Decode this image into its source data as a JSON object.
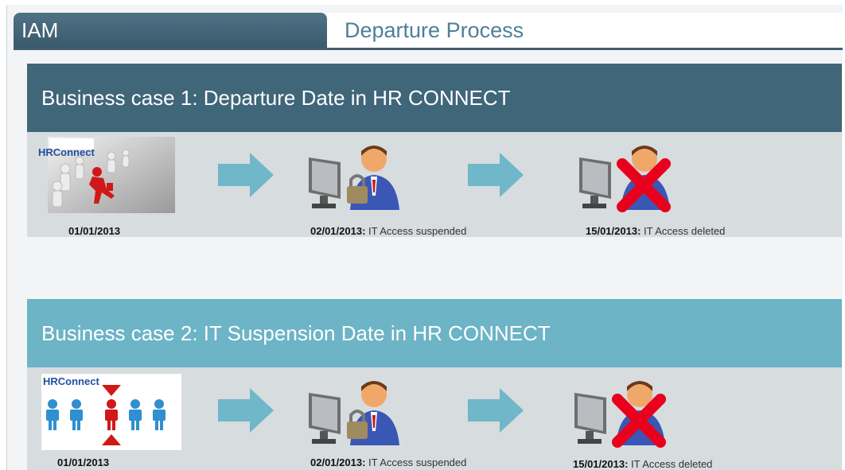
{
  "tabs": {
    "active": "IAM",
    "title": "Departure Process"
  },
  "cases": [
    {
      "title": "Business case 1: Departure Date in HR CONNECT",
      "thumb_text": "HRConnect",
      "start_date": "01/01/2013",
      "steps": [
        {
          "date": "02/01/2013:",
          "desc": "IT Access suspended"
        },
        {
          "date": "15/01/2013:",
          "desc": "IT Access deleted"
        }
      ]
    },
    {
      "title": "Business case 2: IT Suspension Date in HR CONNECT",
      "thumb_text": "HRConnect",
      "start_date": "01/01/2013",
      "steps": [
        {
          "date": "02/01/2013:",
          "desc": "IT Access suspended"
        },
        {
          "date": "15/01/2013:",
          "desc": "IT Access deleted"
        }
      ]
    }
  ],
  "colors": {
    "header_dark": "#3f6679",
    "header_light": "#6cb4c6",
    "arrow": "#6fb7c9",
    "red_x": "#e8001c"
  }
}
